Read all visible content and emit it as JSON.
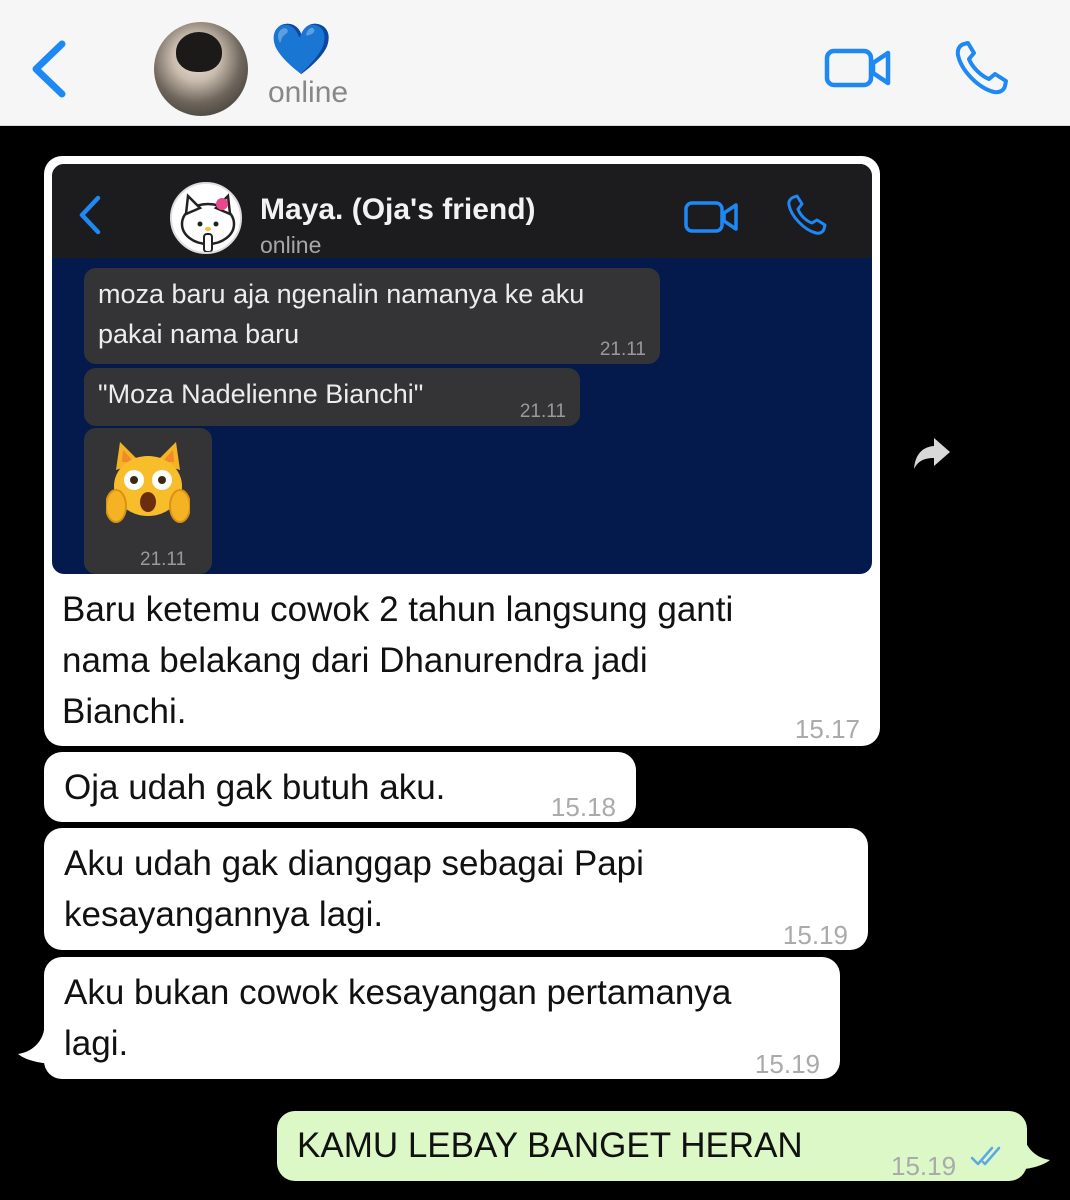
{
  "header": {
    "contact_emoji": "💙",
    "contact_status": "online",
    "icons": [
      "chevron-left-icon",
      "video-camera-icon",
      "phone-icon"
    ],
    "accent_color": "#1e88f5"
  },
  "forwarded_screenshot": {
    "contact_name": "Maya. (Oja's friend)",
    "contact_status": "online",
    "messages": [
      {
        "text": "moza baru aja ngenalin namanya ke aku\npakai nama baru",
        "time": "21.11"
      },
      {
        "text": "\"Moza Nadelienne Bianchi\"",
        "time": "21.11"
      },
      {
        "emoji": "shocked-cat",
        "time": "21.11"
      }
    ]
  },
  "messages": [
    {
      "text": "Baru ketemu cowok 2 tahun langsung ganti\nnama belakang dari Dhanurendra jadi\nBianchi.",
      "time": "15.17",
      "direction": "incoming"
    },
    {
      "text": "Oja udah gak butuh aku.",
      "time": "15.18",
      "direction": "incoming"
    },
    {
      "text": "Aku udah gak dianggap sebagai Papi\nkesayangannya lagi.",
      "time": "15.19",
      "direction": "incoming"
    },
    {
      "text": "Aku bukan cowok kesayangan pertamanya\nlagi.",
      "time": "15.19",
      "direction": "incoming"
    },
    {
      "text": "KAMU LEBAY BANGET HERAN",
      "time": "15.19",
      "direction": "outgoing",
      "status": "read"
    }
  ],
  "colors": {
    "background": "#000000",
    "incoming_bubble": "#ffffff",
    "outgoing_bubble": "#dcf8c6",
    "screenshot_background": "#041a4c"
  }
}
